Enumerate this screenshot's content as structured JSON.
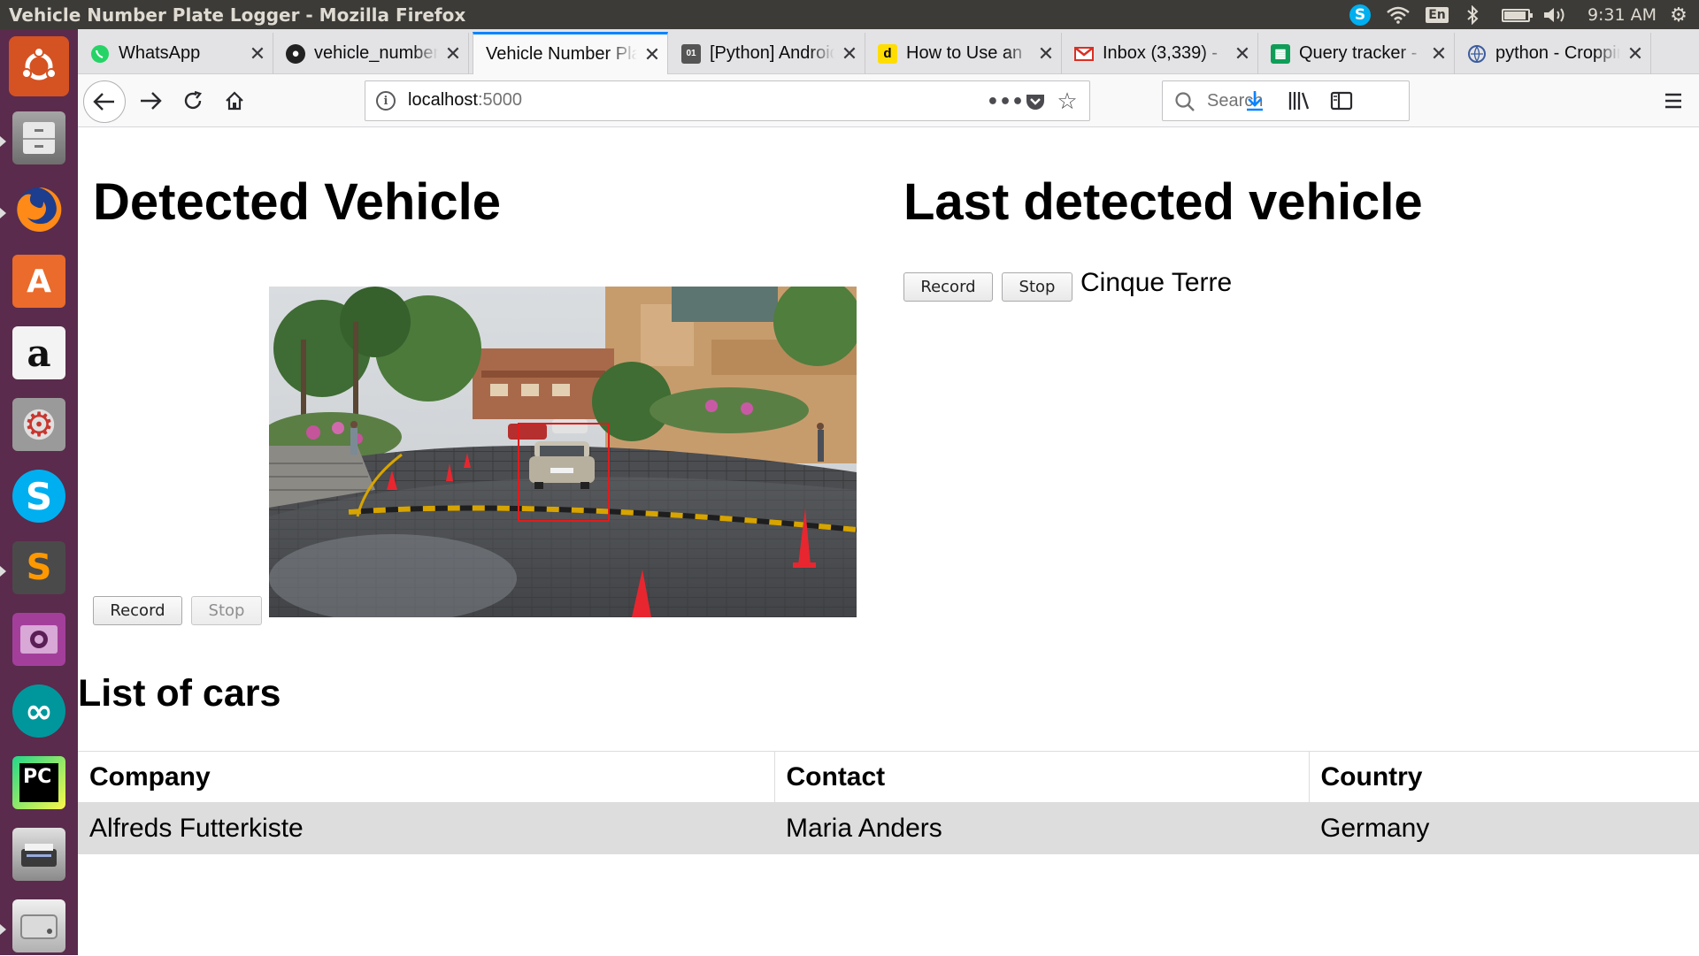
{
  "system": {
    "window_title": "Vehicle Number Plate Logger - Mozilla Firefox",
    "clock": "9:31 AM",
    "keyboard_layout": "En",
    "battery_level": 0.85,
    "icons": {
      "skype_tray": "skype-icon",
      "wifi": "wifi-icon",
      "bluetooth": "bluetooth-icon",
      "battery": "battery-icon",
      "volume": "volume-icon",
      "power": "gear-icon"
    }
  },
  "launcher": {
    "items": [
      {
        "name": "ubuntu-dash",
        "icon": "ubuntu-logo-icon",
        "color": "#d55222"
      },
      {
        "name": "files",
        "icon": "file-cabinet-icon",
        "color": "#8d8d8d"
      },
      {
        "name": "firefox",
        "icon": "firefox-icon",
        "color": "#e66000"
      },
      {
        "name": "ubuntu-software",
        "icon": "shopping-bag-icon",
        "color": "#ea6b2b"
      },
      {
        "name": "amazon",
        "icon": "amazon-icon",
        "color": "#f3f3f3"
      },
      {
        "name": "system-settings",
        "icon": "wrench-gear-icon",
        "color": "#c8362f"
      },
      {
        "name": "skype",
        "icon": "skype-icon",
        "color": "#00aff0"
      },
      {
        "name": "sublime-text",
        "icon": "sublime-icon",
        "color": "#4a4a4a"
      },
      {
        "name": "screen-recorder",
        "icon": "film-camera-icon",
        "color": "#a33f9b"
      },
      {
        "name": "arduino",
        "icon": "infinity-icon",
        "color": "#00979c"
      },
      {
        "name": "pycharm",
        "icon": "pycharm-icon",
        "color": "#21d789"
      },
      {
        "name": "scanner",
        "icon": "scanner-icon",
        "color": "#c0c0c0"
      },
      {
        "name": "drive",
        "icon": "hard-drive-icon",
        "color": "#d7d7d7"
      }
    ]
  },
  "tabs": [
    {
      "label": "WhatsApp",
      "icon": "whatsapp-icon",
      "active": false
    },
    {
      "label": "vehicle_number_plate",
      "icon": "github-icon",
      "active": false
    },
    {
      "label": "Vehicle Number Plate Logger",
      "icon": "",
      "active": true
    },
    {
      "label": "[Python] Android",
      "icon": "code-icon",
      "active": false
    },
    {
      "label": "How to Use an",
      "icon": "d-icon",
      "active": false
    },
    {
      "label": "Inbox (3,339) -",
      "icon": "gmail-icon",
      "active": false
    },
    {
      "label": "Query tracker -",
      "icon": "sheets-icon",
      "active": false
    },
    {
      "label": "python - Cropping",
      "icon": "stackoverflow-icon",
      "active": false
    }
  ],
  "navbar": {
    "url_host": "localhost",
    "url_port": ":5000",
    "search_placeholder": "Search"
  },
  "page": {
    "detected_title": "Detected Vehicle",
    "last_title": "Last detected vehicle",
    "record_label": "Record",
    "stop_label": "Stop",
    "last_vehicle_value": "Cinque Terre",
    "list_title": "List of cars",
    "table": {
      "headers": [
        "Company",
        "Contact",
        "Country"
      ],
      "rows": [
        [
          "Alfreds Futterkiste",
          "Maria Anders",
          "Germany"
        ]
      ]
    }
  }
}
